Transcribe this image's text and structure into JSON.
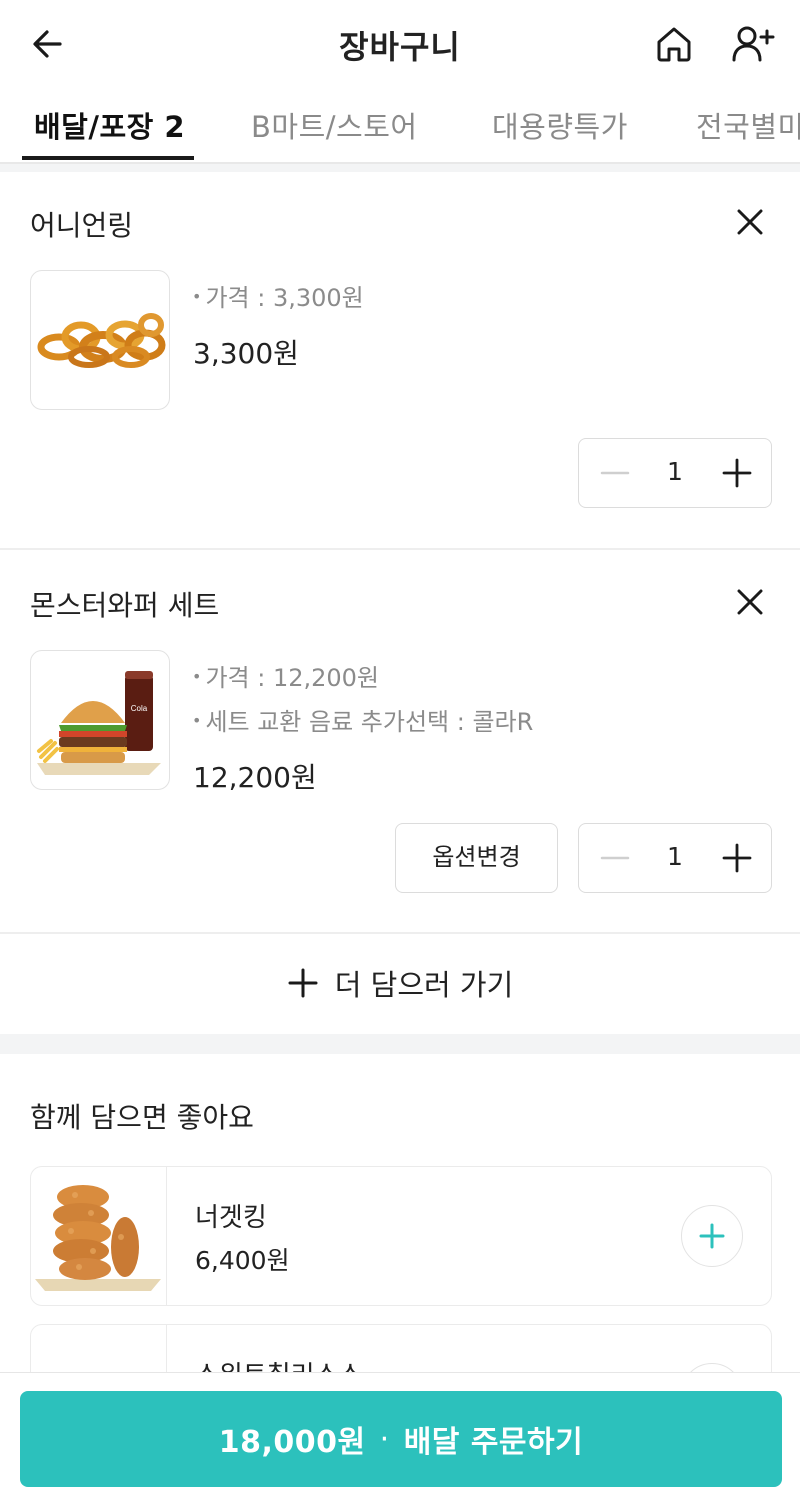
{
  "header": {
    "title": "장바구니"
  },
  "tabs": [
    {
      "label": "배달/포장 2"
    },
    {
      "label": "B마트/스토어"
    },
    {
      "label": "대용량특가"
    },
    {
      "label": "전국별미"
    }
  ],
  "cart": {
    "items": [
      {
        "name": "어니언링",
        "details": [
          "가격 : 3,300원"
        ],
        "price": "3,300원",
        "quantity": "1",
        "image_icon": "onion-rings-image"
      },
      {
        "name": "몬스터와퍼 세트",
        "details": [
          "가격 : 12,200원",
          "세트 교환 음료 추가선택 : 콜라R"
        ],
        "price": "12,200원",
        "quantity": "1",
        "option_button": "옵션변경",
        "image_icon": "burger-set-image"
      }
    ],
    "add_more": "더 담으러 가기"
  },
  "recommend": {
    "title": "함께 담으면 좋아요",
    "items": [
      {
        "name": "너겟킹",
        "price": "6,400원",
        "image_icon": "nuggets-image"
      },
      {
        "name": "스위트칠리소스",
        "price": "",
        "image_icon": "sauce-image"
      }
    ]
  },
  "order": {
    "total": "18,000원",
    "separator": "·",
    "label": "배달 주문하기"
  },
  "colors": {
    "accent": "#2cc1bc",
    "muted_text": "#8b8b8b"
  }
}
